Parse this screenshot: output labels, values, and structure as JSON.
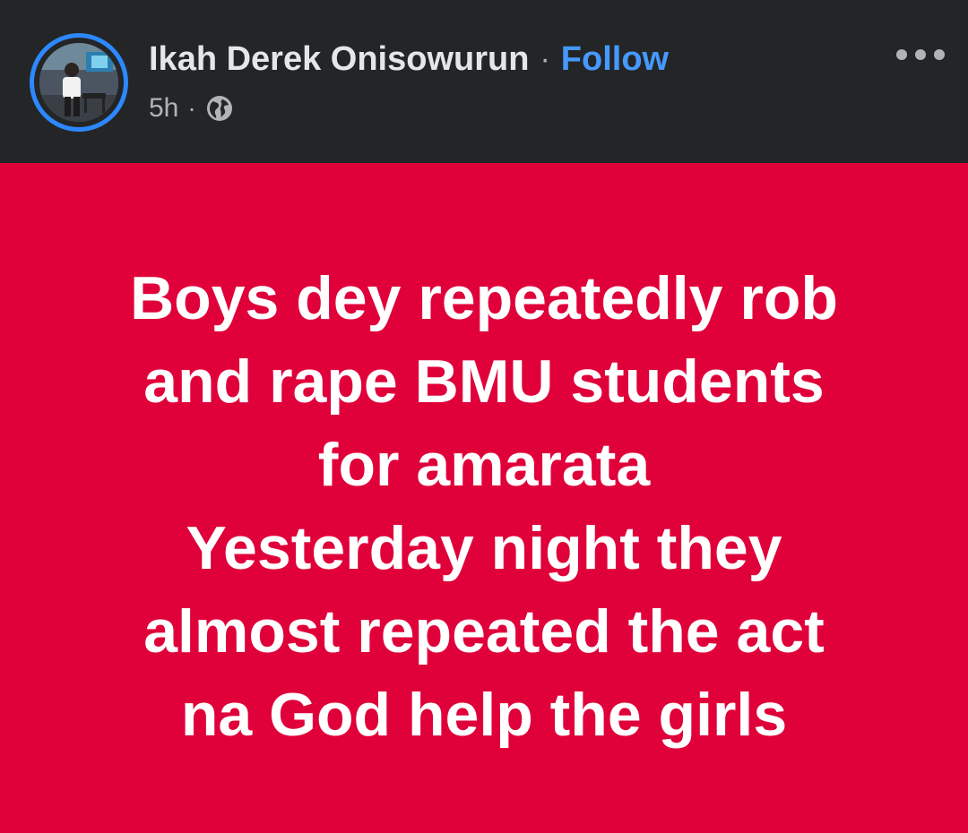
{
  "header": {
    "author_name": "Ikah Derek Onisowurun",
    "separator": "·",
    "follow_label": "Follow",
    "time": "5h",
    "meta_separator": "·",
    "privacy_icon": "globe-icon",
    "more_icon": "more-options-icon"
  },
  "post": {
    "background_color": "#e0003a",
    "lines": [
      "Boys dey repeatedly rob",
      "and rape BMU students",
      "for amarata",
      "Yesterday night they",
      "almost repeated the act",
      "na God help the girls"
    ]
  },
  "colors": {
    "header_bg": "#242526",
    "follow_link": "#4599ff",
    "avatar_ring": "#2d88ff"
  }
}
